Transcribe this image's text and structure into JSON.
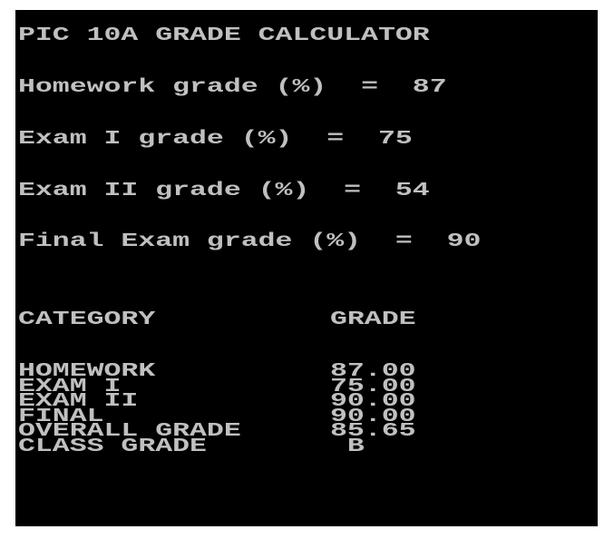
{
  "console": {
    "background": "#000000",
    "text_color": "#c0c0c0",
    "title": "PIC 10A GRADE CALCULATOR",
    "inputs": [
      {
        "label": "Homework grade (%)",
        "sep": "  =  ",
        "value": "87"
      },
      {
        "label": "Exam I grade (%)",
        "sep": "  =  ",
        "value": "75"
      },
      {
        "label": "Exam II grade (%)",
        "sep": "  =  ",
        "value": "54"
      },
      {
        "label": "Final Exam grade (%)",
        "sep": "  =  ",
        "value": "90"
      }
    ],
    "table": {
      "headers": [
        "CATEGORY",
        "GRADE"
      ],
      "rows": [
        {
          "category": "HOMEWORK",
          "grade": "87.00"
        },
        {
          "category": "EXAM I",
          "grade": "75.00"
        },
        {
          "category": "EXAM II",
          "grade": "90.00"
        },
        {
          "category": "FINAL",
          "grade": "90.00"
        },
        {
          "category": "OVERALL GRADE",
          "grade": "85.65"
        },
        {
          "category": "CLASS GRADE",
          "grade": " B"
        }
      ]
    }
  }
}
